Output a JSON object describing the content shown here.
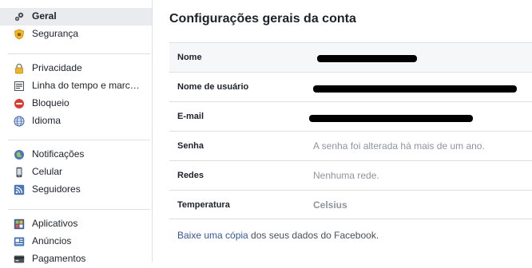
{
  "sidebar": {
    "group1": [
      {
        "label": "Geral",
        "icon": "gears-icon",
        "selected": true
      },
      {
        "label": "Segurança",
        "icon": "shield-icon"
      }
    ],
    "group2": [
      {
        "label": "Privacidade",
        "icon": "lock-icon"
      },
      {
        "label": "Linha do tempo e marc…",
        "icon": "timeline-icon"
      },
      {
        "label": "Bloqueio",
        "icon": "block-icon"
      },
      {
        "label": "Idioma",
        "icon": "globe-icon"
      }
    ],
    "group3": [
      {
        "label": "Notificações",
        "icon": "globe-bell-icon"
      },
      {
        "label": "Celular",
        "icon": "phone-icon"
      },
      {
        "label": "Seguidores",
        "icon": "rss-icon"
      }
    ],
    "group4": [
      {
        "label": "Aplicativos",
        "icon": "apps-icon"
      },
      {
        "label": "Anúncios",
        "icon": "ads-icon"
      },
      {
        "label": "Pagamentos",
        "icon": "payments-icon"
      }
    ]
  },
  "main": {
    "title": "Configurações gerais da conta",
    "rows": [
      {
        "key": "Nome",
        "value": ""
      },
      {
        "key": "Nome de usuário",
        "value": ""
      },
      {
        "key": "E-mail",
        "value": ""
      },
      {
        "key": "Senha",
        "value": "A senha foi alterada há mais de um ano."
      },
      {
        "key": "Redes",
        "value": "Nenhuma rede."
      },
      {
        "key": "Temperatura",
        "value": "Celsius"
      }
    ],
    "download_link": "Baixe uma cópia",
    "download_rest": " dos seus dados do Facebook."
  },
  "colors": {
    "link": "#365899",
    "muted": "#90949c",
    "border": "#dddfe2",
    "selected_bg": "#e9ebee"
  }
}
